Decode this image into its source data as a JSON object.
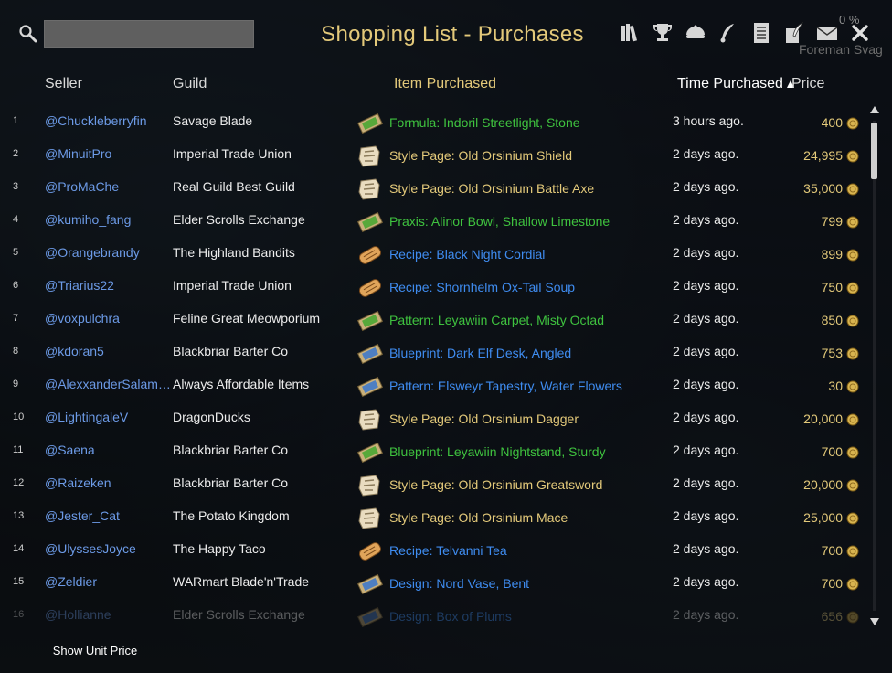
{
  "title": "Shopping List - Purchases",
  "search": {
    "value": "",
    "placeholder": ""
  },
  "toolbar": {
    "icons": [
      "books-icon",
      "trophy-icon",
      "helmet-icon",
      "feather-quill-icon",
      "ledger-icon",
      "quill-paper-icon",
      "mail-icon",
      "close-icon"
    ]
  },
  "status": {
    "percent": "0 %",
    "user": "Foreman Svag"
  },
  "columns": {
    "seller": "Seller",
    "guild": "Guild",
    "item": "Item Purchased",
    "time": "Time Purchased",
    "price": "Price"
  },
  "colors": {
    "seller": "#6c9ae6",
    "item_green": "#3fc23f",
    "item_blue": "#3f8cf0",
    "item_gold": "#e3c97a",
    "price": "#e3c97a"
  },
  "rows": [
    {
      "num": "1",
      "seller": "@Chuckleberryfin",
      "guild": "Savage Blade",
      "item": "Formula: Indoril Streetlight, Stone",
      "item_color": "#3fc23f",
      "icon": "green-scroll-icon",
      "time": "3 hours ago.",
      "price": "400"
    },
    {
      "num": "2",
      "seller": "@MinuitPro",
      "guild": "Imperial Trade Union",
      "item": "Style Page: Old Orsinium Shield",
      "item_color": "#e3c97a",
      "icon": "style-page-icon",
      "time": "2 days ago.",
      "price": "24,995"
    },
    {
      "num": "3",
      "seller": "@ProMaChe",
      "guild": "Real Guild Best Guild",
      "item": "Style Page: Old Orsinium Battle Axe",
      "item_color": "#e3c97a",
      "icon": "style-page-icon",
      "time": "2 days ago.",
      "price": "35,000"
    },
    {
      "num": "4",
      "seller": "@kumiho_fang",
      "guild": "Elder Scrolls Exchange",
      "item": "Praxis: Alinor Bowl, Shallow Limestone",
      "item_color": "#3fc23f",
      "icon": "green-scroll-icon",
      "time": "2 days ago.",
      "price": "799"
    },
    {
      "num": "5",
      "seller": "@Orangebrandy",
      "guild": "The Highland Bandits",
      "item": "Recipe: Black Night Cordial",
      "item_color": "#3f8cf0",
      "icon": "recipe-scroll-icon",
      "time": "2 days ago.",
      "price": "899"
    },
    {
      "num": "6",
      "seller": "@Triarius22",
      "guild": "Imperial Trade Union",
      "item": "Recipe: Shornhelm Ox-Tail Soup",
      "item_color": "#3f8cf0",
      "icon": "recipe-scroll-icon",
      "time": "2 days ago.",
      "price": "750"
    },
    {
      "num": "7",
      "seller": "@voxpulchra",
      "guild": "Feline Great Meowporium",
      "item": "Pattern: Leyawiin Carpet, Misty Octad",
      "item_color": "#3fc23f",
      "icon": "green-scroll-icon",
      "time": "2 days ago.",
      "price": "850"
    },
    {
      "num": "8",
      "seller": "@kdoran5",
      "guild": "Blackbriar Barter Co",
      "item": "Blueprint: Dark Elf Desk, Angled",
      "item_color": "#3f8cf0",
      "icon": "blue-scroll-icon",
      "time": "2 days ago.",
      "price": "753"
    },
    {
      "num": "9",
      "seller": "@AlexxanderSalam…",
      "guild": "Always Affordable Items",
      "item": "Pattern: Elsweyr Tapestry, Water Flowers",
      "item_color": "#3f8cf0",
      "icon": "blue-scroll-icon",
      "time": "2 days ago.",
      "price": "30"
    },
    {
      "num": "10",
      "seller": "@LightingaleV",
      "guild": "DragonDucks",
      "item": "Style Page: Old Orsinium Dagger",
      "item_color": "#e3c97a",
      "icon": "style-page-icon",
      "time": "2 days ago.",
      "price": "20,000"
    },
    {
      "num": "11",
      "seller": "@Saena",
      "guild": "Blackbriar Barter Co",
      "item": "Blueprint: Leyawiin Nightstand, Sturdy",
      "item_color": "#3fc23f",
      "icon": "green-scroll-icon",
      "time": "2 days ago.",
      "price": "700"
    },
    {
      "num": "12",
      "seller": "@Raizeken",
      "guild": "Blackbriar Barter Co",
      "item": "Style Page: Old Orsinium Greatsword",
      "item_color": "#e3c97a",
      "icon": "style-page-icon",
      "time": "2 days ago.",
      "price": "20,000"
    },
    {
      "num": "13",
      "seller": "@Jester_Cat",
      "guild": "The Potato Kingdom",
      "item": "Style Page: Old Orsinium Mace",
      "item_color": "#e3c97a",
      "icon": "style-page-icon",
      "time": "2 days ago.",
      "price": "25,000"
    },
    {
      "num": "14",
      "seller": "@UlyssesJoyce",
      "guild": "The Happy Taco",
      "item": "Recipe: Telvanni Tea",
      "item_color": "#3f8cf0",
      "icon": "recipe-scroll-icon",
      "time": "2 days ago.",
      "price": "700"
    },
    {
      "num": "15",
      "seller": "@Zeldier",
      "guild": "WARmart Blade'n'Trade",
      "item": "Design: Nord Vase, Bent",
      "item_color": "#3f8cf0",
      "icon": "blue-scroll-icon",
      "time": "2 days ago.",
      "price": "700"
    },
    {
      "num": "16",
      "seller": "@Hollianne",
      "guild": "Elder Scrolls Exchange",
      "item": "Design: Box of Plums",
      "item_color": "#3f8cf0",
      "icon": "blue-scroll-icon",
      "time": "2 days ago.",
      "price": "656",
      "faded": true
    }
  ],
  "footer": {
    "unit_price_button": "Show Unit Price"
  }
}
